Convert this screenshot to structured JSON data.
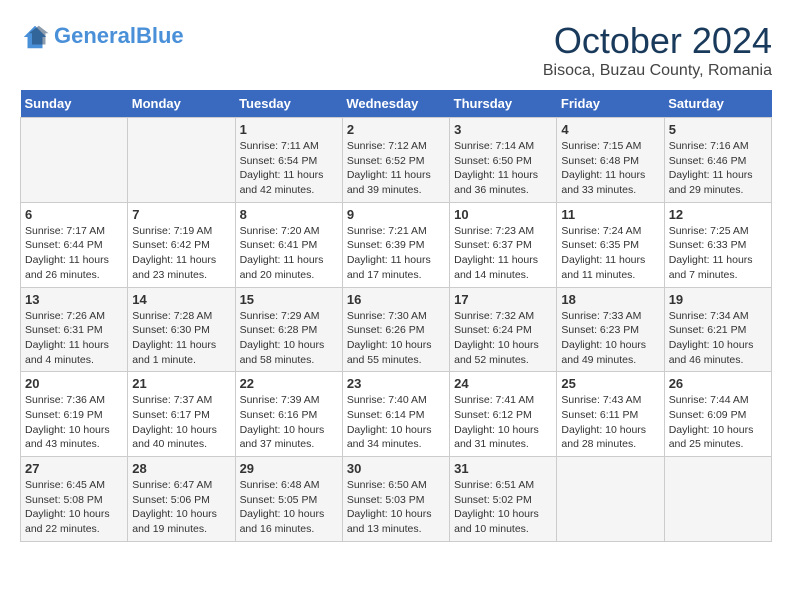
{
  "header": {
    "logo_line1": "General",
    "logo_line2": "Blue",
    "month_title": "October 2024",
    "subtitle": "Bisoca, Buzau County, Romania"
  },
  "weekdays": [
    "Sunday",
    "Monday",
    "Tuesday",
    "Wednesday",
    "Thursday",
    "Friday",
    "Saturday"
  ],
  "weeks": [
    [
      {
        "day": "",
        "info": ""
      },
      {
        "day": "",
        "info": ""
      },
      {
        "day": "1",
        "info": "Sunrise: 7:11 AM\nSunset: 6:54 PM\nDaylight: 11 hours and 42 minutes."
      },
      {
        "day": "2",
        "info": "Sunrise: 7:12 AM\nSunset: 6:52 PM\nDaylight: 11 hours and 39 minutes."
      },
      {
        "day": "3",
        "info": "Sunrise: 7:14 AM\nSunset: 6:50 PM\nDaylight: 11 hours and 36 minutes."
      },
      {
        "day": "4",
        "info": "Sunrise: 7:15 AM\nSunset: 6:48 PM\nDaylight: 11 hours and 33 minutes."
      },
      {
        "day": "5",
        "info": "Sunrise: 7:16 AM\nSunset: 6:46 PM\nDaylight: 11 hours and 29 minutes."
      }
    ],
    [
      {
        "day": "6",
        "info": "Sunrise: 7:17 AM\nSunset: 6:44 PM\nDaylight: 11 hours and 26 minutes."
      },
      {
        "day": "7",
        "info": "Sunrise: 7:19 AM\nSunset: 6:42 PM\nDaylight: 11 hours and 23 minutes."
      },
      {
        "day": "8",
        "info": "Sunrise: 7:20 AM\nSunset: 6:41 PM\nDaylight: 11 hours and 20 minutes."
      },
      {
        "day": "9",
        "info": "Sunrise: 7:21 AM\nSunset: 6:39 PM\nDaylight: 11 hours and 17 minutes."
      },
      {
        "day": "10",
        "info": "Sunrise: 7:23 AM\nSunset: 6:37 PM\nDaylight: 11 hours and 14 minutes."
      },
      {
        "day": "11",
        "info": "Sunrise: 7:24 AM\nSunset: 6:35 PM\nDaylight: 11 hours and 11 minutes."
      },
      {
        "day": "12",
        "info": "Sunrise: 7:25 AM\nSunset: 6:33 PM\nDaylight: 11 hours and 7 minutes."
      }
    ],
    [
      {
        "day": "13",
        "info": "Sunrise: 7:26 AM\nSunset: 6:31 PM\nDaylight: 11 hours and 4 minutes."
      },
      {
        "day": "14",
        "info": "Sunrise: 7:28 AM\nSunset: 6:30 PM\nDaylight: 11 hours and 1 minute."
      },
      {
        "day": "15",
        "info": "Sunrise: 7:29 AM\nSunset: 6:28 PM\nDaylight: 10 hours and 58 minutes."
      },
      {
        "day": "16",
        "info": "Sunrise: 7:30 AM\nSunset: 6:26 PM\nDaylight: 10 hours and 55 minutes."
      },
      {
        "day": "17",
        "info": "Sunrise: 7:32 AM\nSunset: 6:24 PM\nDaylight: 10 hours and 52 minutes."
      },
      {
        "day": "18",
        "info": "Sunrise: 7:33 AM\nSunset: 6:23 PM\nDaylight: 10 hours and 49 minutes."
      },
      {
        "day": "19",
        "info": "Sunrise: 7:34 AM\nSunset: 6:21 PM\nDaylight: 10 hours and 46 minutes."
      }
    ],
    [
      {
        "day": "20",
        "info": "Sunrise: 7:36 AM\nSunset: 6:19 PM\nDaylight: 10 hours and 43 minutes."
      },
      {
        "day": "21",
        "info": "Sunrise: 7:37 AM\nSunset: 6:17 PM\nDaylight: 10 hours and 40 minutes."
      },
      {
        "day": "22",
        "info": "Sunrise: 7:39 AM\nSunset: 6:16 PM\nDaylight: 10 hours and 37 minutes."
      },
      {
        "day": "23",
        "info": "Sunrise: 7:40 AM\nSunset: 6:14 PM\nDaylight: 10 hours and 34 minutes."
      },
      {
        "day": "24",
        "info": "Sunrise: 7:41 AM\nSunset: 6:12 PM\nDaylight: 10 hours and 31 minutes."
      },
      {
        "day": "25",
        "info": "Sunrise: 7:43 AM\nSunset: 6:11 PM\nDaylight: 10 hours and 28 minutes."
      },
      {
        "day": "26",
        "info": "Sunrise: 7:44 AM\nSunset: 6:09 PM\nDaylight: 10 hours and 25 minutes."
      }
    ],
    [
      {
        "day": "27",
        "info": "Sunrise: 6:45 AM\nSunset: 5:08 PM\nDaylight: 10 hours and 22 minutes."
      },
      {
        "day": "28",
        "info": "Sunrise: 6:47 AM\nSunset: 5:06 PM\nDaylight: 10 hours and 19 minutes."
      },
      {
        "day": "29",
        "info": "Sunrise: 6:48 AM\nSunset: 5:05 PM\nDaylight: 10 hours and 16 minutes."
      },
      {
        "day": "30",
        "info": "Sunrise: 6:50 AM\nSunset: 5:03 PM\nDaylight: 10 hours and 13 minutes."
      },
      {
        "day": "31",
        "info": "Sunrise: 6:51 AM\nSunset: 5:02 PM\nDaylight: 10 hours and 10 minutes."
      },
      {
        "day": "",
        "info": ""
      },
      {
        "day": "",
        "info": ""
      }
    ]
  ]
}
